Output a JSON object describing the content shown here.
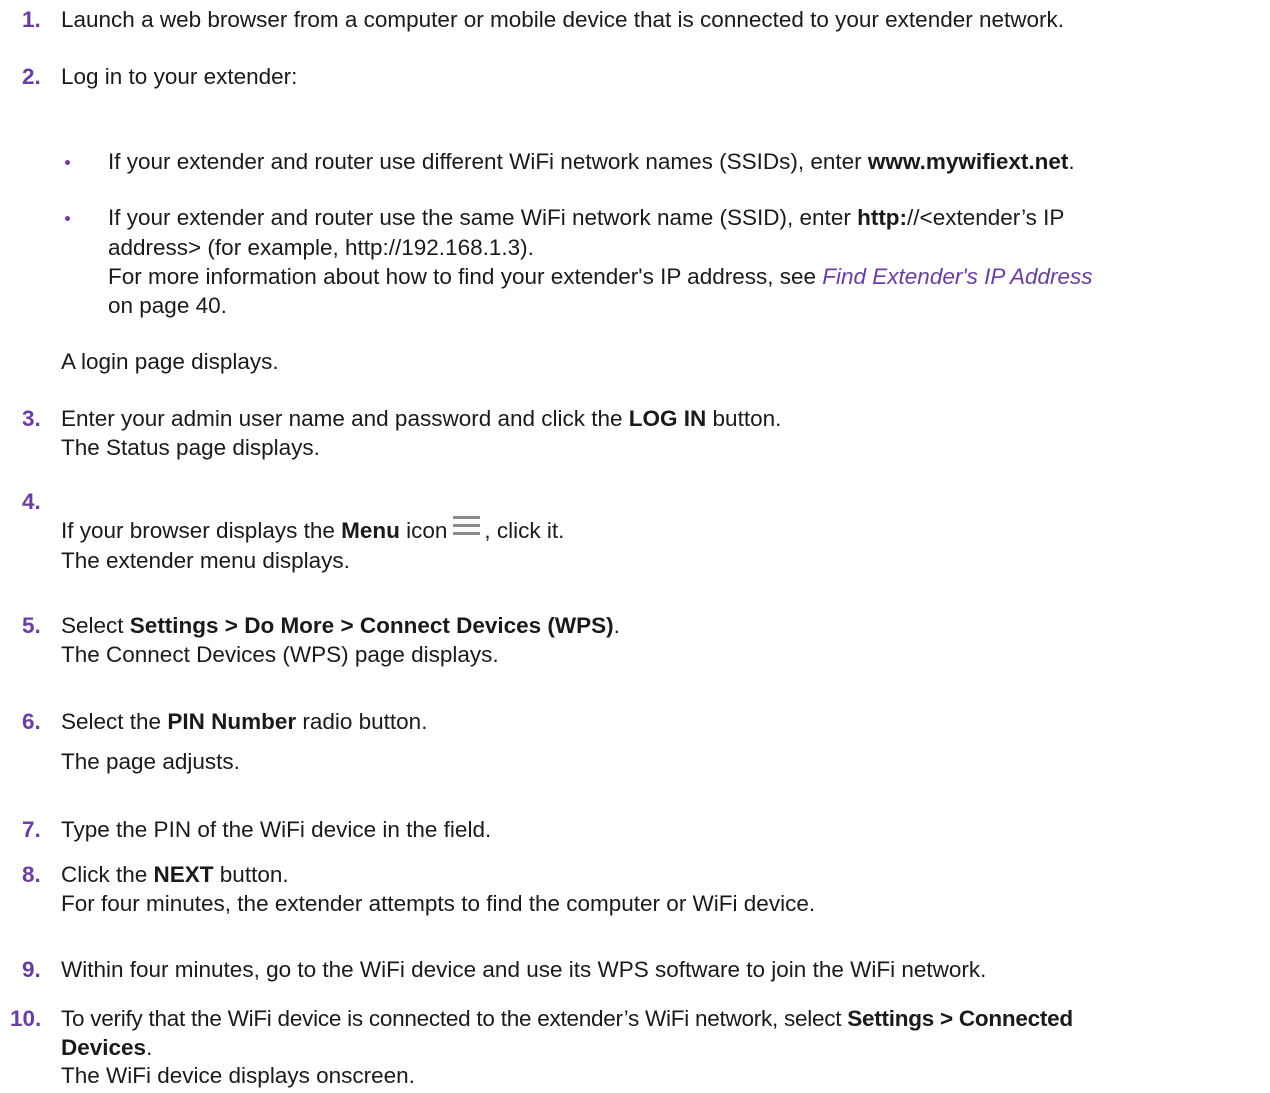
{
  "steps": {
    "s1": {
      "num": "1.",
      "text": "Launch a web browser from a computer or mobile device that is connected to your extender network."
    },
    "s2": {
      "num": "2.",
      "text": "Log in to your extender:",
      "bullet1": {
        "pre": "If your extender and router use different WiFi network names (SSIDs), enter ",
        "bold": "www.mywifiext.net",
        "post": "."
      },
      "bullet2": {
        "pre": "If your extender and router use the same WiFi network name (SSID), enter ",
        "bold": "http:",
        "post": "//<extender’s IP",
        "line2": "address> (for example, http://192.168.1.3).",
        "line3_pre": "For more information about how to find your extender's IP address, see ",
        "line3_link": "Find Extender's IP Address",
        "line4": "on page 40."
      },
      "result": "A login page displays."
    },
    "s3": {
      "num": "3.",
      "pre": "Enter your admin user name and password and click the ",
      "bold": "LOG IN",
      "post": " button.",
      "result": "The Status page displays."
    },
    "s4": {
      "num": "4.",
      "pre": "If your browser displays the ",
      "bold": "Menu",
      "mid": " icon",
      "post": ", click it.",
      "result": "The extender menu displays."
    },
    "s5": {
      "num": "5.",
      "pre": "Select ",
      "bold": "Settings > Do More > Connect Devices (WPS)",
      "post": ".",
      "result": "The Connect Devices (WPS) page displays."
    },
    "s6": {
      "num": "6.",
      "pre": "Select the ",
      "bold": "PIN Number",
      "post": " radio button.",
      "result": "The page adjusts."
    },
    "s7": {
      "num": "7.",
      "text": "Type the PIN of the WiFi device in the field."
    },
    "s8": {
      "num": "8.",
      "pre": "Click the ",
      "bold": "NEXT",
      "post": " button.",
      "result": "For four minutes, the extender attempts to find the computer or WiFi device."
    },
    "s9": {
      "num": "9.",
      "text": "Within four minutes, go to the WiFi device and use its WPS software to join the WiFi network."
    },
    "s10": {
      "num": "10.",
      "pre": "To verify that the WiFi device is connected to the extender’s WiFi network, select ",
      "bold1": "Settings > Connected",
      "bold2": "Devices",
      "post": ".",
      "result": "The WiFi device displays onscreen."
    }
  },
  "icons": {
    "menu": "hamburger-menu-icon"
  },
  "colors": {
    "accent": "#6a3ea0",
    "text": "#1a1a1a",
    "icon": "#8c8c8c"
  }
}
